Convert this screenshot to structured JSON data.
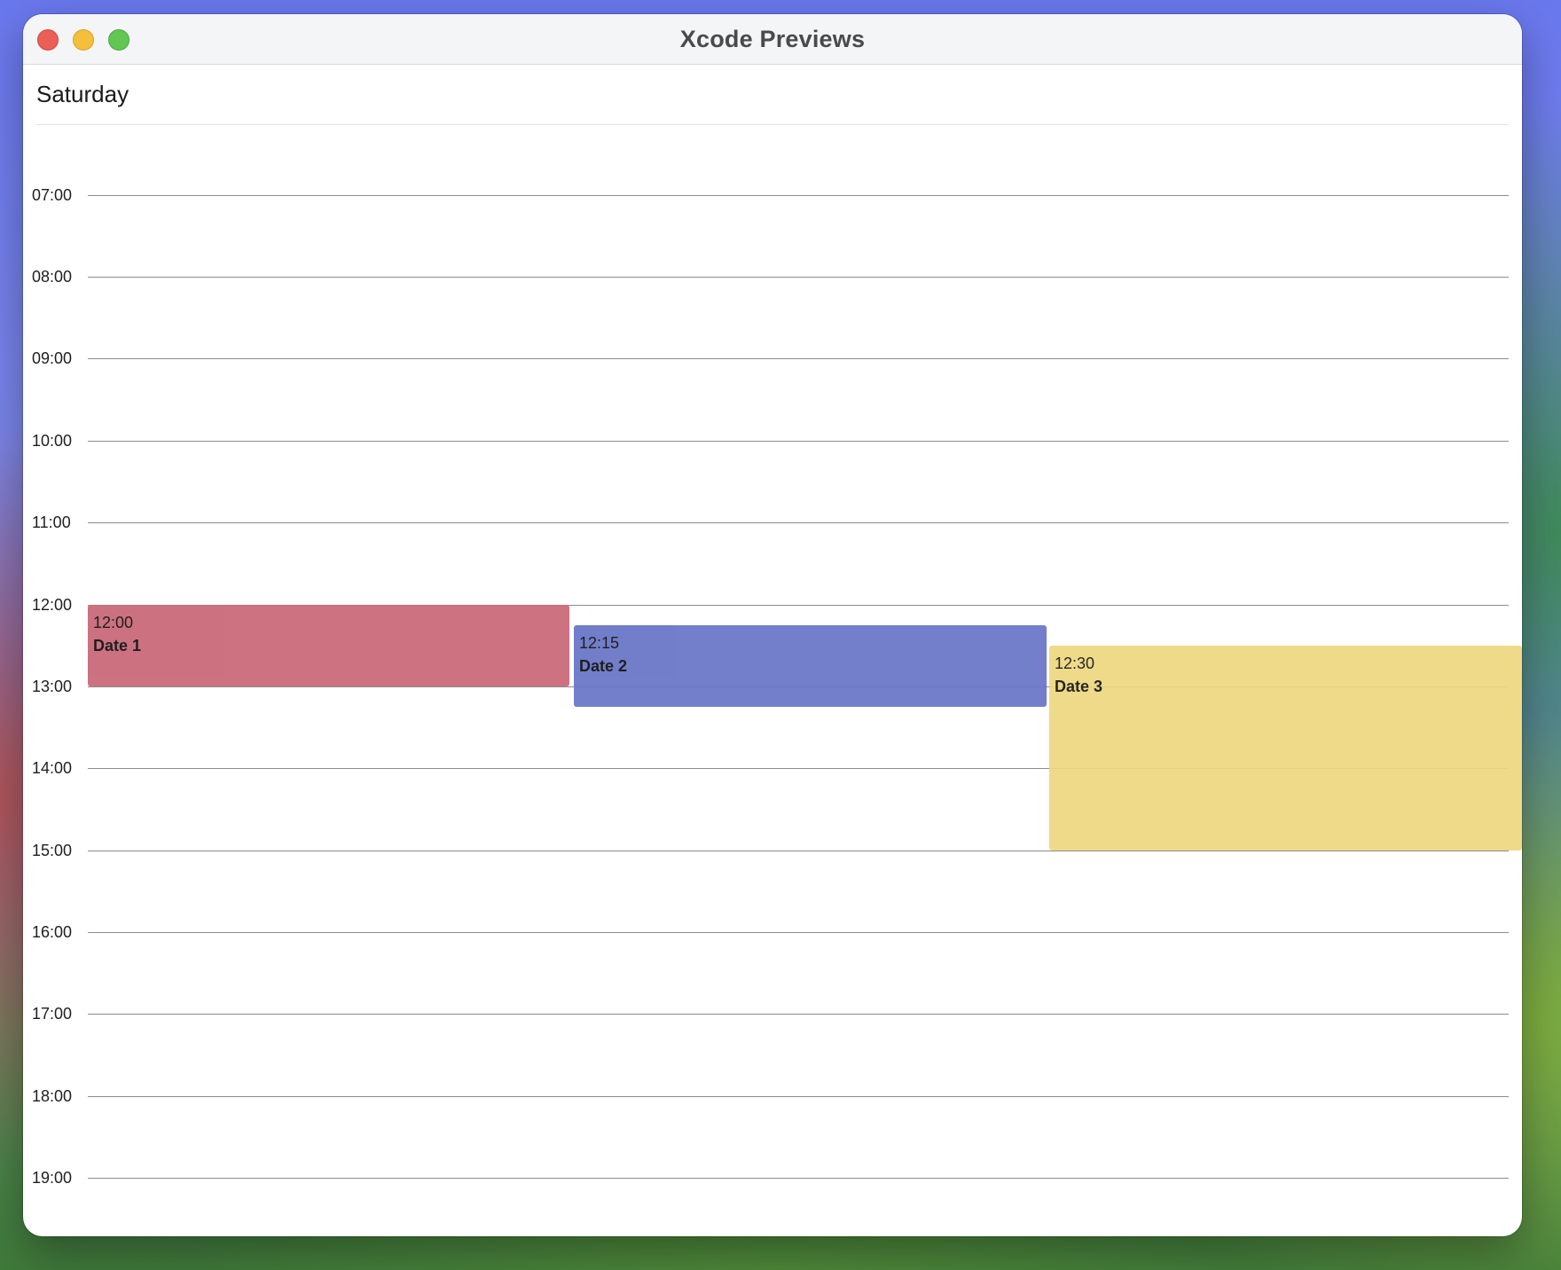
{
  "window": {
    "title": "Xcode Previews"
  },
  "calendar": {
    "day": "Saturday",
    "hours": [
      "07:00",
      "08:00",
      "09:00",
      "10:00",
      "11:00",
      "12:00",
      "13:00",
      "14:00",
      "15:00",
      "16:00",
      "17:00",
      "18:00",
      "19:00"
    ],
    "events": [
      {
        "time": "12:00",
        "title": "Date 1",
        "color": "#c96a7a"
      },
      {
        "time": "12:15",
        "title": "Date 2",
        "color": "#6b78c8"
      },
      {
        "time": "12:30",
        "title": "Date 3",
        "color": "#eed780"
      }
    ]
  }
}
